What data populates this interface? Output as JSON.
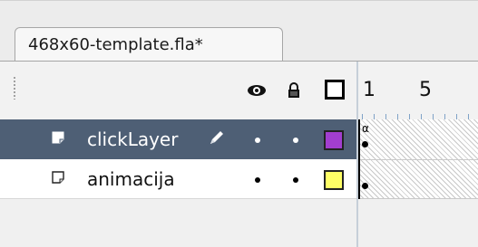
{
  "document_tab": {
    "label": "468x60-template.fla*"
  },
  "timeline_header": {
    "visibility_icon": "eye-icon",
    "lock_icon": "lock-icon",
    "outline_icon": "outline-square-icon",
    "frame_numbers": [
      "1",
      "5"
    ]
  },
  "layers": [
    {
      "name": "clickLayer",
      "selected": true,
      "color": "#a23ecf",
      "keyframe_label": "α"
    },
    {
      "name": "animacija",
      "selected": false,
      "color": "#ffff66"
    }
  ],
  "colors": {
    "selected_row": "#4e5f75",
    "ruler_ticks": "#7fa2c7"
  }
}
